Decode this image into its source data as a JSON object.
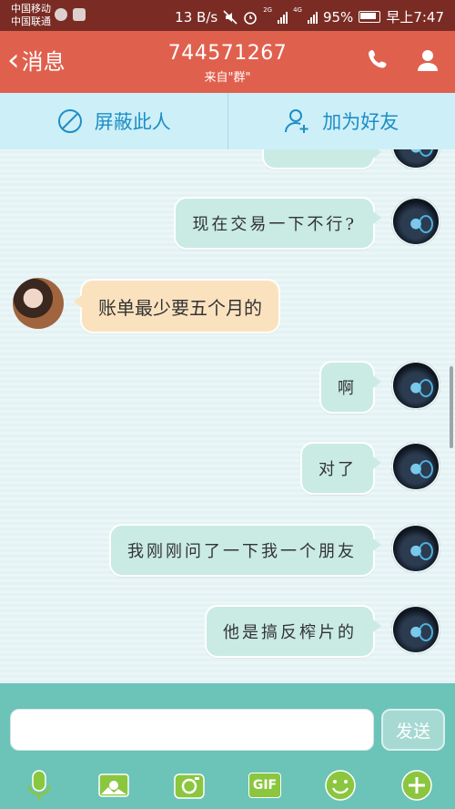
{
  "status_bar": {
    "carrier_1": "中国移动",
    "carrier_2": "中国联通",
    "speed": "13 B/s",
    "net_1": "2G",
    "net_2": "4G",
    "battery": "95%",
    "time": "早上7:47"
  },
  "header": {
    "back_label": "消息",
    "title": "744571267",
    "subtitle": "来自\"群\""
  },
  "actions": {
    "block": "屏蔽此人",
    "add_friend": "加为好友"
  },
  "messages": [
    {
      "side": "right",
      "text": ""
    },
    {
      "side": "right",
      "text": "现在交易一下不行?"
    },
    {
      "side": "left",
      "text": "账单最少要五个月的"
    },
    {
      "side": "right",
      "text": "啊"
    },
    {
      "side": "right",
      "text": "对了"
    },
    {
      "side": "right",
      "text": "我刚刚问了一下我一个朋友"
    },
    {
      "side": "right",
      "text": "他是搞反榨片的"
    }
  ],
  "composer": {
    "input_value": "",
    "send_label": "发送",
    "tools": [
      "microphone-icon",
      "picture-icon",
      "camera-icon",
      "gif-icon",
      "emoji-icon",
      "plus-icon"
    ],
    "gif_label": "GIF"
  },
  "colors": {
    "header": "#e0604e",
    "status_bar": "#7a2c24",
    "action_text": "#1e8ec4",
    "composer": "#6cc3b8",
    "tool_green": "#8bc63f"
  }
}
